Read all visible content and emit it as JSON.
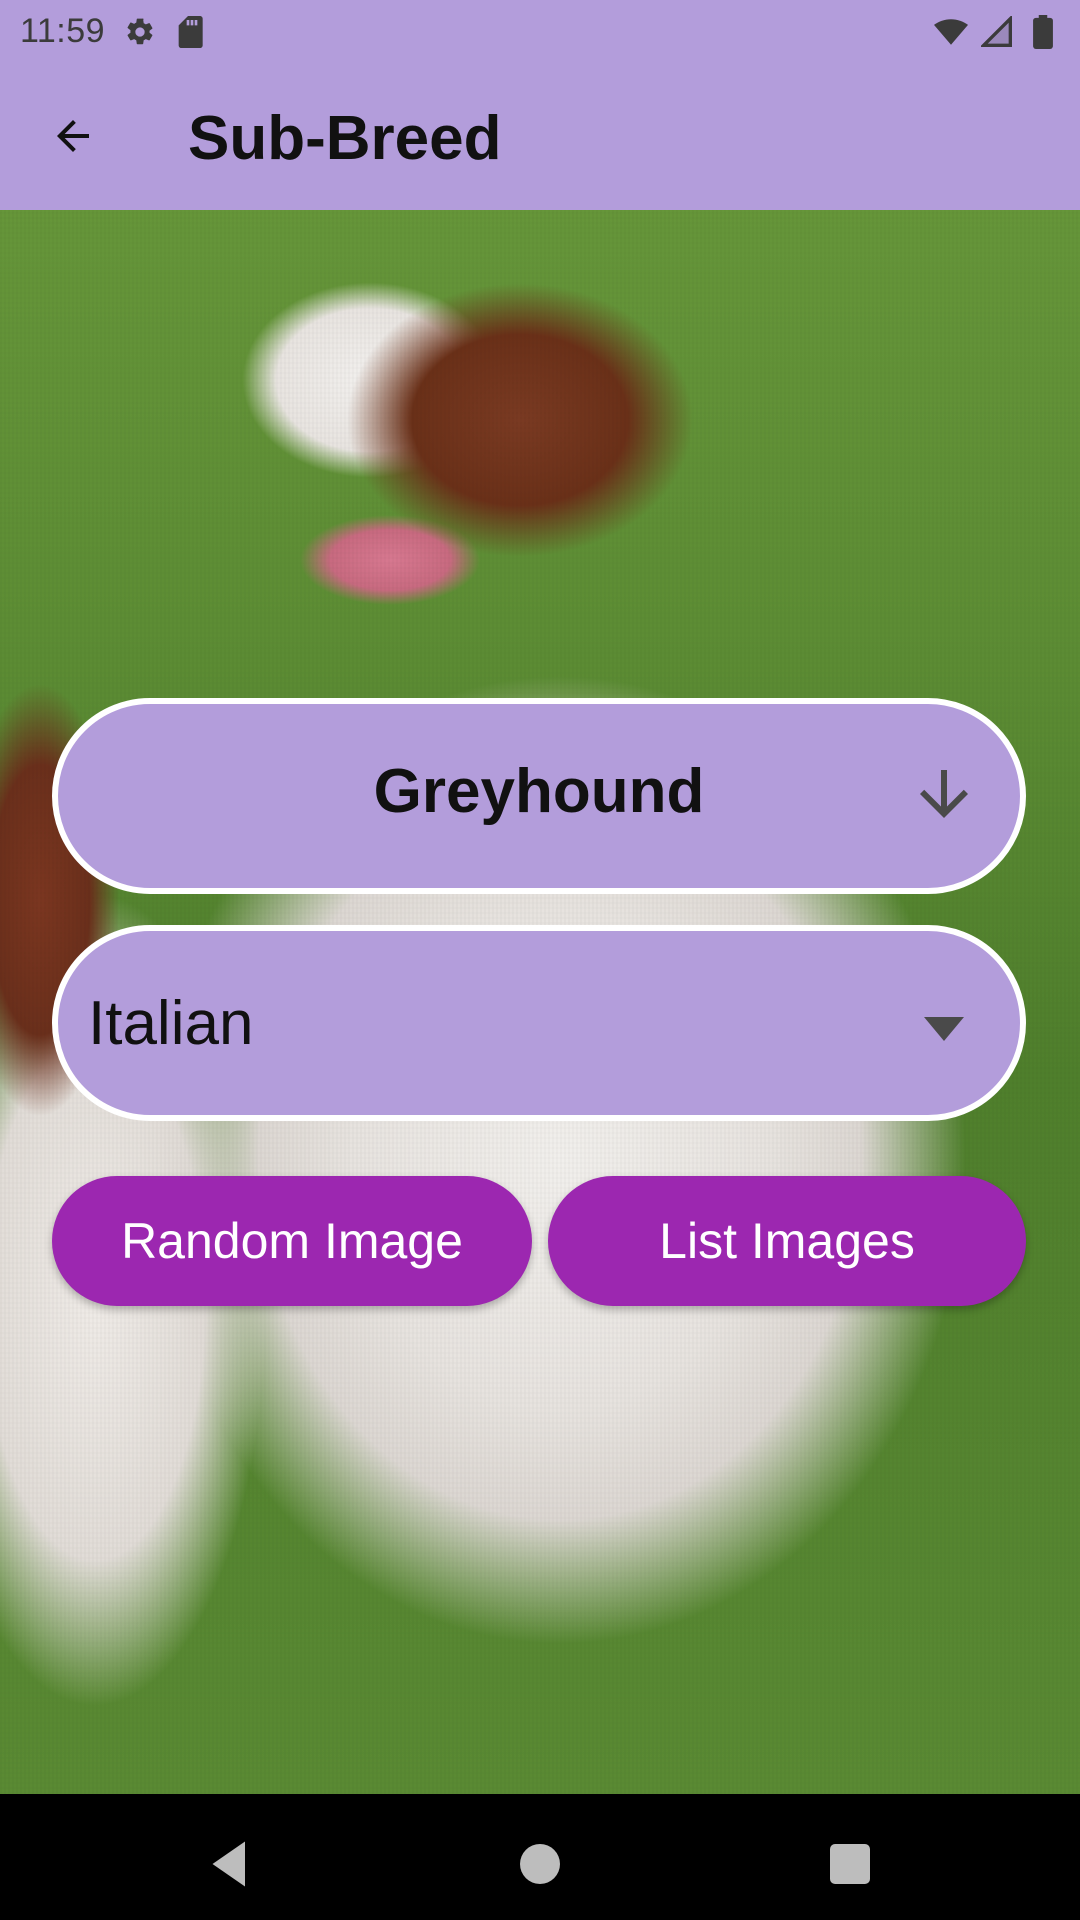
{
  "status_bar": {
    "time": "11:59",
    "left_icons": [
      "settings-icon",
      "sd-card-icon"
    ],
    "right_icons": [
      "wifi-icon",
      "signal-icon",
      "battery-icon"
    ]
  },
  "app_bar": {
    "title": "Sub-Breed",
    "back_icon": "back-arrow-icon"
  },
  "breed_selector": {
    "label": "Greyhound",
    "arrow_icon": "down-arrow-icon"
  },
  "sub_breed_dropdown": {
    "selected": "Italian",
    "caret_icon": "dropdown-caret-icon"
  },
  "actions": {
    "random_label": "Random Image",
    "list_label": "List Images"
  },
  "colors": {
    "app_bar": "#b39ddb",
    "button": "#9c27b0",
    "nav_bar": "#000000"
  },
  "nav": {
    "icons": [
      "nav-back-icon",
      "nav-home-icon",
      "nav-recents-icon"
    ]
  }
}
